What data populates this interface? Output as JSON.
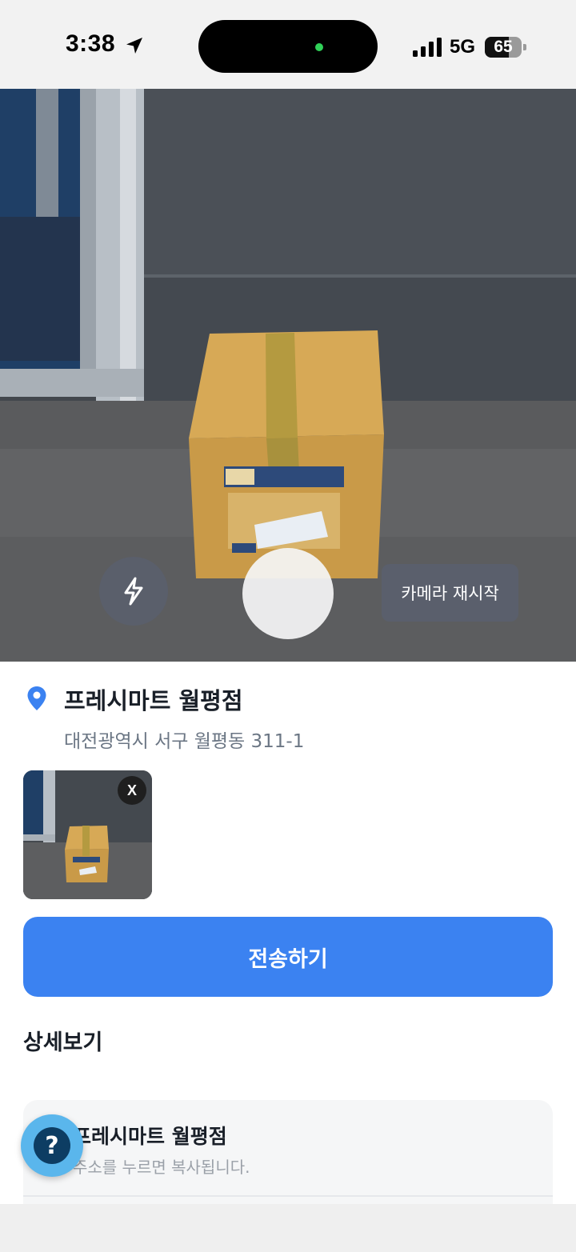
{
  "status_bar": {
    "time": "3:38",
    "network": "5G",
    "battery": "65",
    "battery_level": 0.65
  },
  "camera": {
    "flash_icon": "flash-icon",
    "restart_label": "카메라 재시작"
  },
  "location": {
    "icon": "map-pin-icon",
    "name": "프레시마트 월평점",
    "address": "대전광역시 서구 월평동 311-1"
  },
  "photo": {
    "remove_label": "X"
  },
  "actions": {
    "send_label": "전송하기"
  },
  "details": {
    "title": "상세보기",
    "card_name": "프레시마트 월평점",
    "card_hint": "주소를 누르면 복사됩니다."
  },
  "help": {
    "icon": "help-icon",
    "label": "?"
  },
  "colors": {
    "primary": "#3b82f1",
    "pin": "#3b82f1",
    "help_outer": "#5ab6ec",
    "help_inner": "#0d3d63"
  }
}
